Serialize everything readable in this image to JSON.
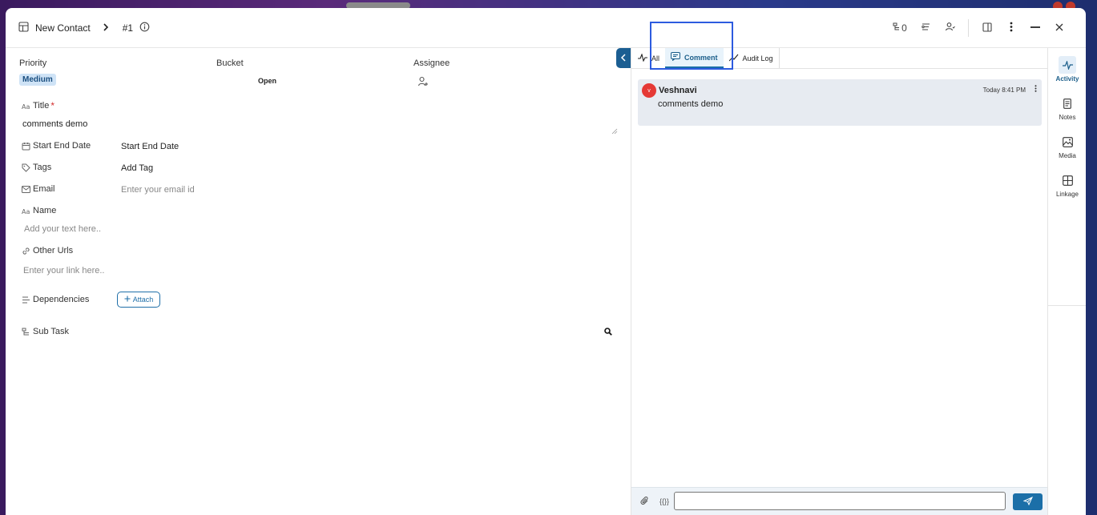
{
  "header": {
    "title": "New Contact",
    "record_id": "#1",
    "count": "0"
  },
  "form": {
    "priority": {
      "label": "Priority",
      "value": "Medium"
    },
    "bucket": {
      "label": "Bucket",
      "value": "Open"
    },
    "assignee": {
      "label": "Assignee"
    },
    "title": {
      "label": "Title",
      "required_mark": "*",
      "value": "comments demo"
    },
    "date": {
      "label": "Start End Date",
      "value": "Start End Date"
    },
    "tags": {
      "label": "Tags",
      "value": "Add Tag"
    },
    "email": {
      "label": "Email",
      "placeholder": "Enter your email id"
    },
    "name": {
      "label": "Name",
      "placeholder": "Add your text here.."
    },
    "urls": {
      "label": "Other Urls",
      "placeholder": "Enter your link here.."
    },
    "dependencies": {
      "label": "Dependencies",
      "button": "Attach"
    },
    "subtask": {
      "label": "Sub Task"
    }
  },
  "activity": {
    "tabs": [
      {
        "label": "All"
      },
      {
        "label": "Comment"
      },
      {
        "label": "Audit Log"
      }
    ],
    "comments": [
      {
        "avatar": "v",
        "author": "Veshnavi",
        "time": "Today 8:41 PM",
        "text": "comments demo"
      }
    ],
    "composer": {
      "variable_glyph": "{{}}",
      "value": ""
    }
  },
  "rail": [
    {
      "label": "Activity"
    },
    {
      "label": "Notes"
    },
    {
      "label": "Media"
    },
    {
      "label": "Linkage"
    }
  ],
  "colors": {
    "accent": "#1b6fa8",
    "highlight": "#2d5bdf",
    "avatar": "#e53935"
  }
}
